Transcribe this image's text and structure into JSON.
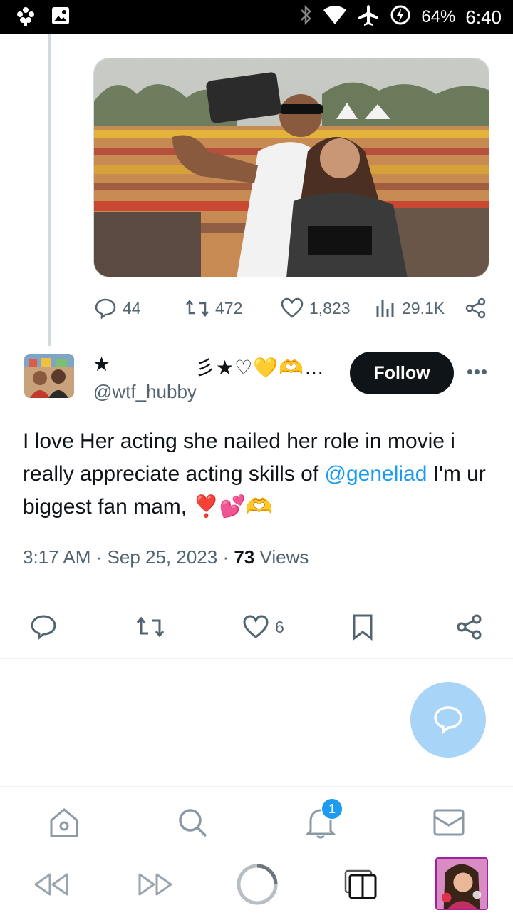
{
  "status_bar": {
    "battery": "64%",
    "time": "6:40"
  },
  "parent_tweet": {
    "stats": {
      "replies": "44",
      "retweets": "472",
      "likes": "1,823",
      "views": "29.1K"
    }
  },
  "reply": {
    "display_name_star": "★",
    "display_name_decor": "彡★♡💛🫶…",
    "handle": "@wtf_hubby",
    "follow_label": "Follow",
    "more_label": "•••",
    "text_part1": "I love Her acting she nailed her role in movie i really appreciate acting skills of ",
    "mention": "@geneliad",
    "text_part2": " I'm ur biggest fan mam, ",
    "emojis": "❣️💕🫶",
    "time": "3:17 AM",
    "separator": " · ",
    "date": "Sep 25, 2023",
    "views_count": "73",
    "views_label": "Views",
    "likes": "6"
  },
  "bottom_nav": {
    "notification_badge": "1"
  },
  "colors": {
    "accent": "#1d9bf0",
    "text_primary": "#0f1419",
    "text_secondary": "#536471",
    "fab": "#a8d5f7"
  }
}
